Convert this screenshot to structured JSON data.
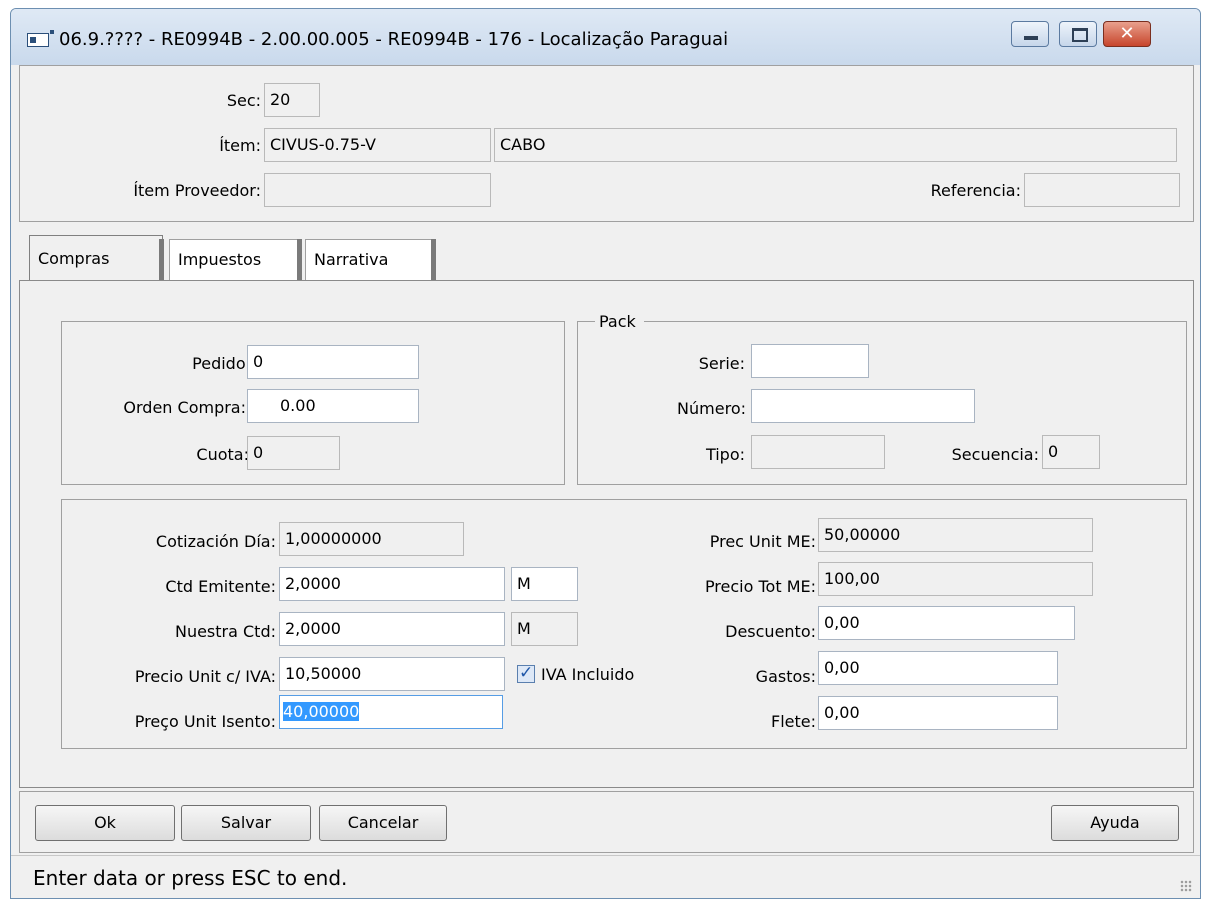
{
  "window": {
    "title": "06.9.???? - RE0994B - 2.00.00.005 - RE0994B - 176 - Localização Paraguai"
  },
  "header": {
    "sec_label": "Sec:",
    "sec_value": "20",
    "item_label": "Ítem:",
    "item_code": "CIVUS-0.75-V",
    "item_desc": "CABO",
    "item_proveedor_label": "Ítem Proveedor:",
    "item_proveedor_value": "",
    "referencia_label": "Referencia:",
    "referencia_value": ""
  },
  "tabs": [
    {
      "label": "Compras"
    },
    {
      "label": "Impuestos"
    },
    {
      "label": "Narrativa"
    }
  ],
  "compras": {
    "pedido_label": "Pedido:",
    "pedido_value": "0",
    "orden_label": "Orden Compra:",
    "orden_value": "0.00",
    "cuota_label": "Cuota:",
    "cuota_value": "0"
  },
  "pack": {
    "title": "Pack",
    "serie_label": "Serie:",
    "serie_value": "",
    "numero_label": "Número:",
    "numero_value": "",
    "tipo_label": "Tipo:",
    "tipo_value": "",
    "secuencia_label": "Secuencia:",
    "secuencia_value": "0"
  },
  "values": {
    "cotizacion_label": "Cotización Día:",
    "cotizacion_value": "1,00000000",
    "ctd_emitente_label": "Ctd Emitente:",
    "ctd_emitente_value": "2,0000",
    "ctd_emitente_unit": "M",
    "nuestra_ctd_label": "Nuestra Ctd:",
    "nuestra_ctd_value": "2,0000",
    "nuestra_ctd_unit": "M",
    "precio_iva_label": "Precio Unit c/ IVA:",
    "precio_iva_value": "10,50000",
    "iva_incluido_label": "IVA Incluido",
    "iva_incluido_checked": true,
    "preco_isento_label": "Preço Unit Isento:",
    "preco_isento_value": "40,00000",
    "prec_unit_me_label": "Prec Unit ME:",
    "prec_unit_me_value": "50,00000",
    "precio_tot_me_label": "Precio Tot ME:",
    "precio_tot_me_value": "100,00",
    "descuento_label": "Descuento:",
    "descuento_value": "0,00",
    "gastos_label": "Gastos:",
    "gastos_value": "0,00",
    "flete_label": "Flete:",
    "flete_value": "0,00"
  },
  "buttons": {
    "ok": "Ok",
    "salvar": "Salvar",
    "cancelar": "Cancelar",
    "ayuda": "Ayuda"
  },
  "status": {
    "text": "Enter data or press ESC to end."
  }
}
